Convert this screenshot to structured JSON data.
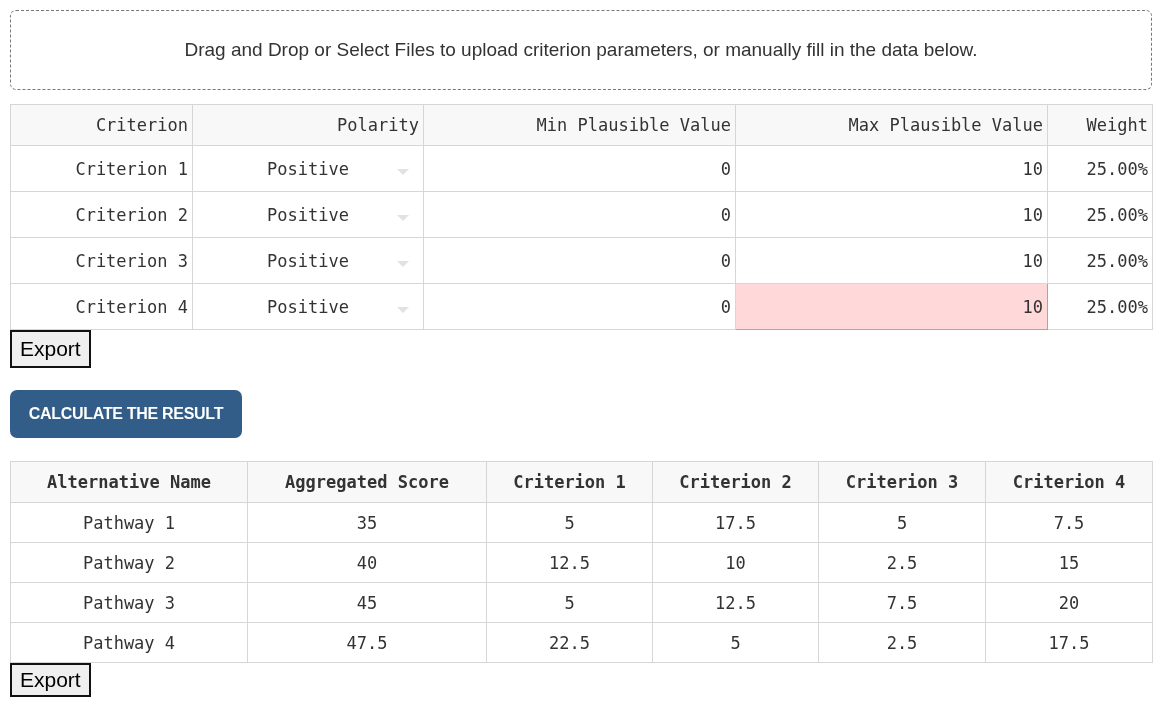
{
  "dropzone": {
    "text": "Drag and Drop or Select Files to upload criterion parameters, or manually fill in the data below."
  },
  "criteria_table": {
    "columns": [
      "Criterion",
      "Polarity",
      "Min Plausible Value",
      "Max Plausible Value",
      "Weight"
    ],
    "rows": [
      {
        "criterion": "Criterion 1",
        "polarity": "Positive",
        "min": "0",
        "max": "10",
        "weight": "25.00%",
        "max_invalid": false
      },
      {
        "criterion": "Criterion 2",
        "polarity": "Positive",
        "min": "0",
        "max": "10",
        "weight": "25.00%",
        "max_invalid": false
      },
      {
        "criterion": "Criterion 3",
        "polarity": "Positive",
        "min": "0",
        "max": "10",
        "weight": "25.00%",
        "max_invalid": false
      },
      {
        "criterion": "Criterion 4",
        "polarity": "Positive",
        "min": "0",
        "max": "10",
        "weight": "25.00%",
        "max_invalid": true
      }
    ]
  },
  "export_button_1": "Export",
  "calculate_button": "CALCULATE THE RESULT",
  "results_table": {
    "columns": [
      "Alternative Name",
      "Aggregated Score",
      "Criterion 1",
      "Criterion 2",
      "Criterion 3",
      "Criterion 4"
    ],
    "rows": [
      [
        "Pathway 1",
        "35",
        "5",
        "17.5",
        "5",
        "7.5"
      ],
      [
        "Pathway 2",
        "40",
        "12.5",
        "10",
        "2.5",
        "15"
      ],
      [
        "Pathway 3",
        "45",
        "5",
        "12.5",
        "7.5",
        "20"
      ],
      [
        "Pathway 4",
        "47.5",
        "22.5",
        "5",
        "2.5",
        "17.5"
      ]
    ]
  },
  "export_button_2": "Export"
}
